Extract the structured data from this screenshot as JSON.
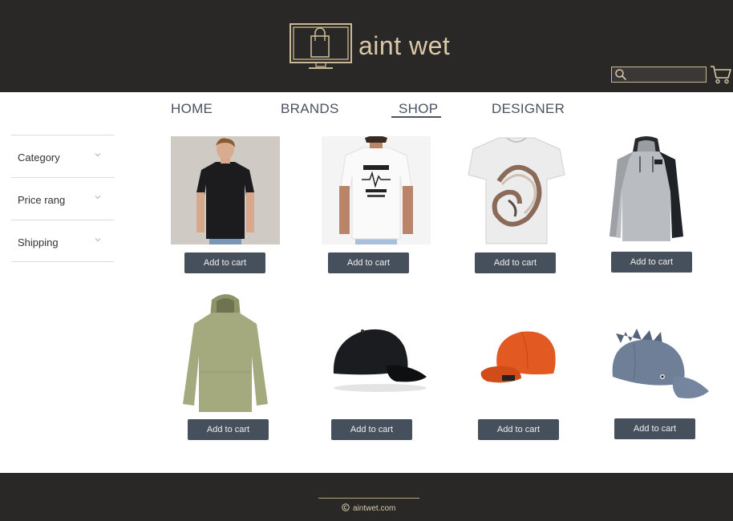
{
  "header": {
    "brand_name": "aint wet",
    "logo_icon": "monitor-shopping-bag-icon",
    "search": {
      "placeholder": "",
      "icon": "search-icon"
    },
    "cart_icon": "shopping-cart-icon"
  },
  "nav": {
    "items": [
      {
        "label": "HOME",
        "active": false
      },
      {
        "label": "BRANDS",
        "active": false
      },
      {
        "label": "SHOP",
        "active": true
      },
      {
        "label": "DESIGNER",
        "active": false
      }
    ]
  },
  "filters": {
    "items": [
      {
        "label": "Category",
        "icon": "chevron-down-icon"
      },
      {
        "label": "Price rang",
        "icon": "chevron-down-icon"
      },
      {
        "label": "Shipping",
        "icon": "chevron-down-icon"
      }
    ]
  },
  "products": {
    "button_label": "Add to cart",
    "items": [
      {
        "kind": "black-tshirt-model"
      },
      {
        "kind": "white-print-tshirt-model"
      },
      {
        "kind": "abstract-print-tshirt"
      },
      {
        "kind": "grey-hoodie"
      },
      {
        "kind": "green-hoodie"
      },
      {
        "kind": "black-cap"
      },
      {
        "kind": "orange-cap"
      },
      {
        "kind": "grey-dino-cap"
      }
    ]
  },
  "footer": {
    "copyright_icon": "copyright-icon",
    "text": "aintwet.com"
  },
  "colors": {
    "header_bg": "#2a2827",
    "accent_gold": "#d9c9a8",
    "nav_text": "#4a5161",
    "button_bg": "#464f5c"
  }
}
